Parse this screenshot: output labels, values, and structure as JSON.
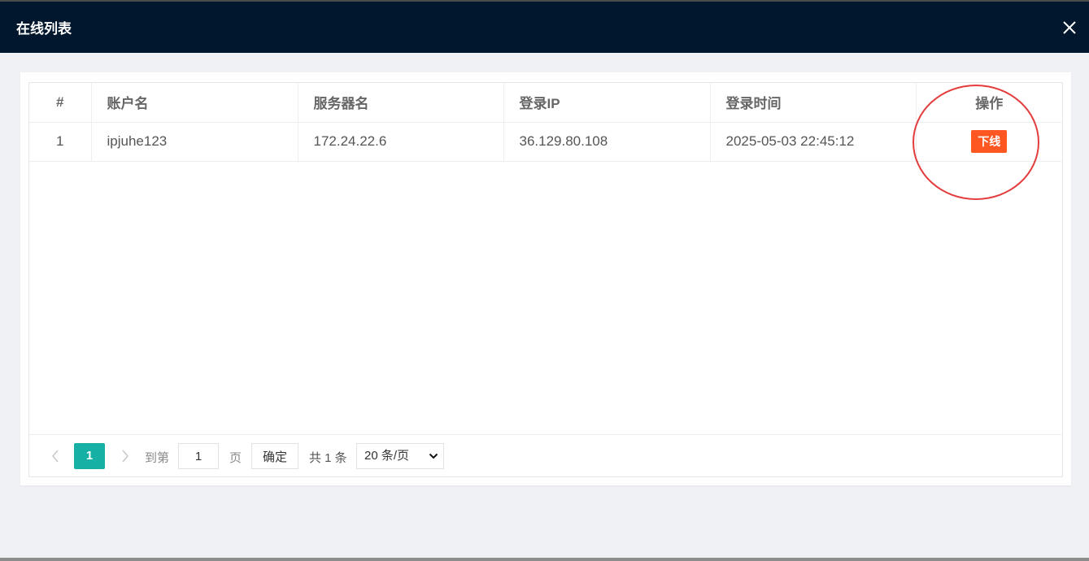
{
  "dialog": {
    "title": "在线列表"
  },
  "table": {
    "headers": [
      "#",
      "账户名",
      "服务器名",
      "登录IP",
      "登录时间",
      "操作"
    ],
    "rows": [
      {
        "index": "1",
        "account": "ipjuhe123",
        "server": "172.24.22.6",
        "ip": "36.129.80.108",
        "login_time": "2025-05-03 22:45:12",
        "action": "下线"
      }
    ]
  },
  "pager": {
    "current_page": "1",
    "goto_label": "到第",
    "goto_value": "1",
    "page_label": "页",
    "confirm_label": "确定",
    "total": "共 1 条",
    "page_size": "20 条/页"
  },
  "colors": {
    "titlebar": "#00172d",
    "accent": "#16b0a5",
    "danger": "#ff5722",
    "highlight_circle": "#e43c3c"
  }
}
